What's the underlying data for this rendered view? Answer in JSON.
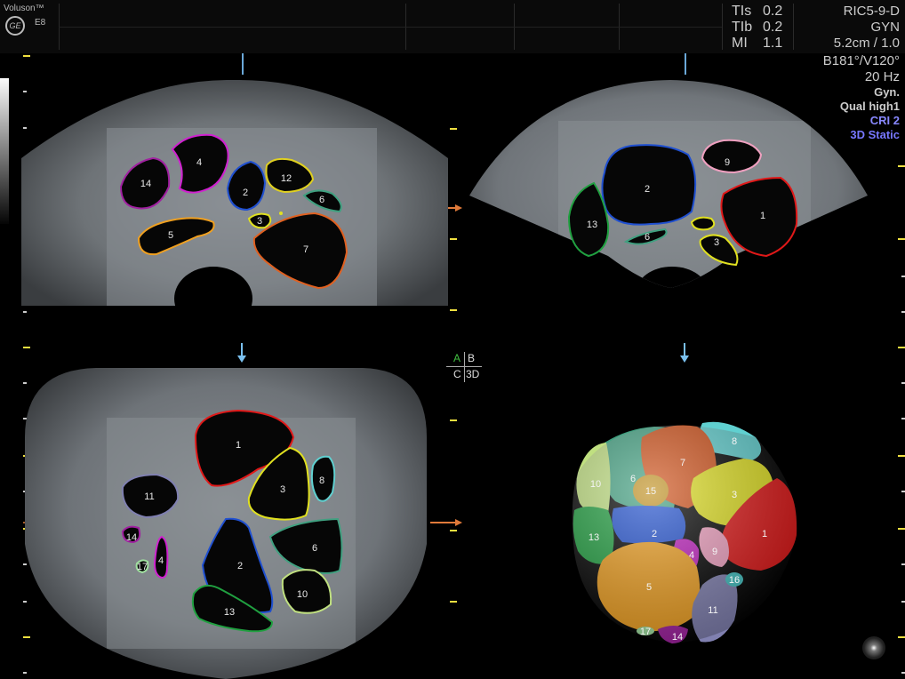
{
  "header": {
    "brand": "Voluson™",
    "logo": "GE",
    "model": "E8",
    "tis_label": "TIs",
    "tis_value": "0.2",
    "tib_label": "TIb",
    "tib_value": "0.2",
    "mi_label": "MI",
    "mi_value": "1.1"
  },
  "settings": {
    "probe": "RIC5-9-D",
    "preset": "GYN",
    "depth": "5.2cm / 1.0",
    "angles": "B181°/V120°",
    "frequency": "20 Hz",
    "mode": "Gyn.",
    "quality": "Qual high1",
    "cri": "CRI 2",
    "static": "3D Static"
  },
  "quadrant": {
    "a": "A",
    "b": "B",
    "c": "C",
    "d": "3D"
  },
  "panel_a": {
    "labels": [
      "14",
      "4",
      "2",
      "12",
      "6",
      "3",
      "5",
      "7"
    ]
  },
  "panel_b": {
    "labels": [
      "9",
      "2",
      "1",
      "13",
      "6",
      "3"
    ]
  },
  "panel_c": {
    "labels": [
      "1",
      "3",
      "8",
      "11",
      "14",
      "17",
      "4",
      "2",
      "6",
      "10",
      "13"
    ]
  },
  "volume": {
    "labels": [
      "8",
      "7",
      "10",
      "6",
      "15",
      "3",
      "13",
      "2",
      "1",
      "4",
      "9",
      "5",
      "16",
      "11",
      "17",
      "14"
    ]
  },
  "colors": {
    "follicle_1": "#e01818",
    "follicle_2": "#2050d0",
    "follicle_3": "#e0e020",
    "follicle_4": "#d020d0",
    "follicle_5": "#f0a020",
    "follicle_6": "#40a080",
    "follicle_7": "#e06020",
    "follicle_8": "#60d0d0",
    "follicle_9": "#f0a0c0",
    "follicle_10": "#c0e080",
    "follicle_11": "#8080b0",
    "follicle_12": "#e0d020",
    "follicle_13": "#20a040",
    "follicle_14": "#a020a0",
    "follicle_15": "#c09020",
    "follicle_16": "#40c0c0",
    "follicle_17": "#a0e0a0"
  }
}
